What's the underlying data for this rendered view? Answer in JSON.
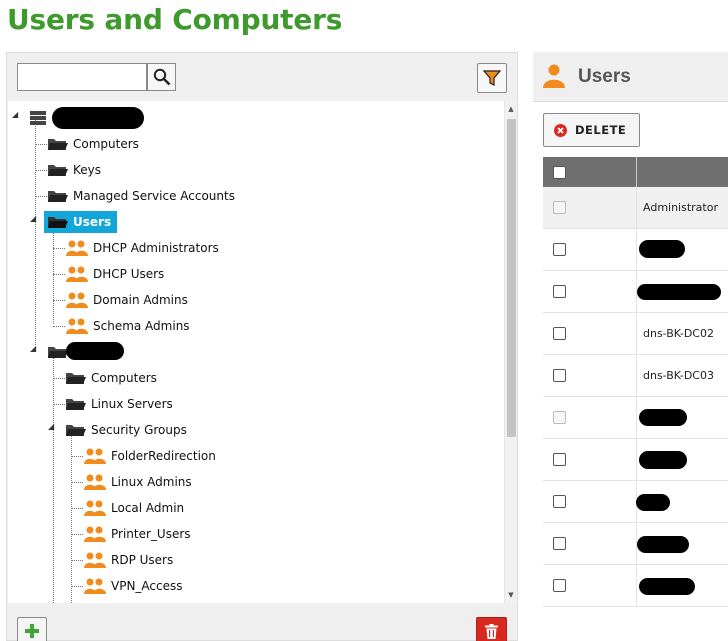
{
  "page": {
    "title": "Users and Computers"
  },
  "search": {
    "placeholder": "",
    "value": ""
  },
  "tree": {
    "root_label": "",
    "items": [
      {
        "label": "Computers",
        "icon": "folder-icon"
      },
      {
        "label": "Keys",
        "icon": "folder-icon"
      },
      {
        "label": "Managed Service Accounts",
        "icon": "folder-icon"
      },
      {
        "label": "Users",
        "icon": "folder-open-icon",
        "selected": true
      },
      {
        "label": "DHCP Administrators",
        "icon": "group-icon"
      },
      {
        "label": "DHCP Users",
        "icon": "group-icon"
      },
      {
        "label": "Domain Admins",
        "icon": "group-icon"
      },
      {
        "label": "Schema Admins",
        "icon": "group-icon"
      },
      {
        "label": "",
        "icon": "folder-icon",
        "redacted": true
      },
      {
        "label": "Computers",
        "icon": "folder-icon"
      },
      {
        "label": "Linux Servers",
        "icon": "folder-icon"
      },
      {
        "label": "Security Groups",
        "icon": "folder-icon"
      },
      {
        "label": "FolderRedirection",
        "icon": "group-icon"
      },
      {
        "label": "Linux Admins",
        "icon": "group-icon"
      },
      {
        "label": "Local Admin",
        "icon": "group-icon"
      },
      {
        "label": "Printer_Users",
        "icon": "group-icon"
      },
      {
        "label": "RDP Users",
        "icon": "group-icon"
      },
      {
        "label": "VPN_Access",
        "icon": "group-icon"
      }
    ]
  },
  "right": {
    "title": "Users",
    "delete_label": "DELETE",
    "rows": [
      {
        "name": "Administrator",
        "checkbox_disabled": true
      },
      {
        "name": "",
        "redacted": true
      },
      {
        "name": "",
        "redacted": true
      },
      {
        "name": "dns-BK-DC02"
      },
      {
        "name": "dns-BK-DC03"
      },
      {
        "name": "",
        "redacted": true,
        "checkbox_disabled": true
      },
      {
        "name": "",
        "redacted": true
      },
      {
        "name": "",
        "redacted": true
      },
      {
        "name": "",
        "redacted": true
      },
      {
        "name": "",
        "redacted": true
      }
    ]
  },
  "colors": {
    "title_green": "#3e9a2d",
    "selected_blue": "#12a7d8",
    "group_orange": "#f08c1e",
    "delete_red": "#d9281f",
    "add_green": "#3fa535"
  }
}
